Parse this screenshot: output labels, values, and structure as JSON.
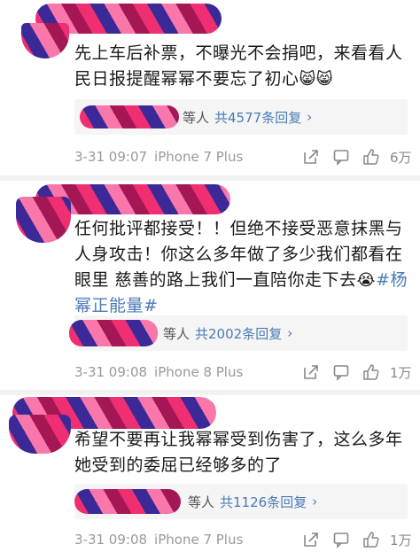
{
  "comments": [
    {
      "text_lines": [
        "先上车后补票，不曝光不会捐吧，来看看人",
        "民日报提醒幂幂不要忘了初心"
      ],
      "emojis": "😸😸",
      "reply": {
        "who": "等人",
        "count": "共4577条回复",
        "chev": "›"
      },
      "time": "3-31 09:07",
      "device": "iPhone 7 Plus",
      "likes": "6万"
    },
    {
      "text_lines": [
        "任何批评都接受！！但绝不接受恶意抹黑与",
        "人身攻击！你这么多年做了多少我们都看在",
        "眼里 慈善的路上我们一直陪你走下去"
      ],
      "emoji_inline": "😭",
      "hashtag_lines": [
        "#杨",
        "幂正能量#"
      ],
      "reply": {
        "who": "等人",
        "count": "共2002条回复",
        "chev": "›"
      },
      "time": "3-31 09:08",
      "device": "iPhone 8 Plus",
      "likes": "1万"
    },
    {
      "text_lines": [
        "希望不要再让我幂幂受到伤害了，这么多年",
        "她受到的委屈已经够多的了"
      ],
      "reply": {
        "who": "等人",
        "count": "共1126条回复",
        "chev": "›"
      },
      "time": "3-31 09:08",
      "device": "iPhone 7 Plus",
      "likes": "1万"
    }
  ],
  "icons": {
    "share": "share-icon",
    "comment": "comment-icon",
    "like": "thumbs-up-icon"
  }
}
